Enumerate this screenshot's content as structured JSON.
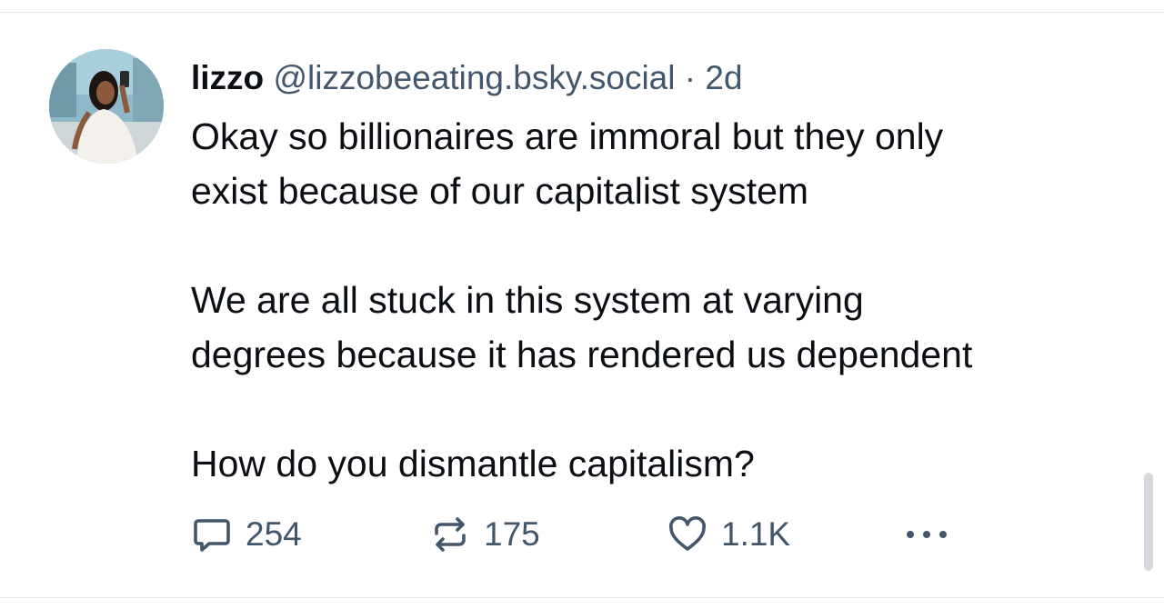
{
  "post": {
    "author": {
      "display_name": "lizzo",
      "handle": "@lizzobeeating.bsky.social",
      "separator": "·",
      "age": "2d",
      "avatar_icon": "user-avatar-photo"
    },
    "paragraphs": [
      "Okay so billionaires are immoral but they only\nexist because of our capitalist system",
      "We are all stuck in this system at varying\ndegrees because it has rendered us dependent",
      "How do you dismantle capitalism?"
    ],
    "actions": {
      "reply": {
        "icon": "comment-icon",
        "count": "254"
      },
      "repost": {
        "icon": "repost-icon",
        "count": "175"
      },
      "like": {
        "icon": "heart-icon",
        "count": "1.1K"
      },
      "more": {
        "icon": "more-options-icon"
      }
    }
  },
  "colors": {
    "text_primary": "#0b0f14",
    "text_secondary": "#42576c",
    "divider": "#e3e6ea",
    "background": "#ffffff"
  }
}
